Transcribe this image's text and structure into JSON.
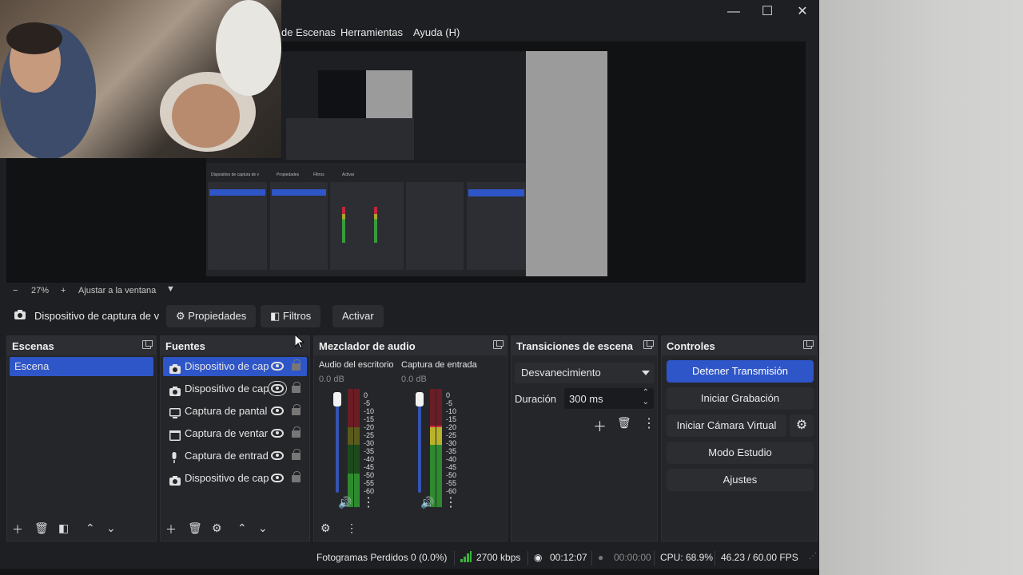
{
  "window": {
    "minimize": "—",
    "maximize": "☐",
    "close": "✕"
  },
  "menu": {
    "items": [
      "de Escenas",
      "Herramientas",
      "Ayuda (H)"
    ]
  },
  "zoom": {
    "minus": "−",
    "value": "27%",
    "plus": "+",
    "fit": "Ajustar a la ventana"
  },
  "context": {
    "source_name": "Dispositivo de captura de v",
    "properties": "Propiedades",
    "filters": "Filtros",
    "activate": "Activar"
  },
  "scenes": {
    "title": "Escenas",
    "items": [
      "Escena"
    ]
  },
  "sources": {
    "title": "Fuentes",
    "items": [
      {
        "label": "Dispositivo de cap",
        "icon": "camera-icon"
      },
      {
        "label": "Dispositivo de cap",
        "icon": "camera-icon"
      },
      {
        "label": "Captura de pantal",
        "icon": "monitor-icon"
      },
      {
        "label": "Captura de ventar",
        "icon": "window-icon"
      },
      {
        "label": "Captura de entrad",
        "icon": "microphone-icon"
      },
      {
        "label": "Dispositivo de cap",
        "icon": "camera-icon"
      }
    ]
  },
  "mixer": {
    "title": "Mezclador de audio",
    "channels": [
      {
        "name": "Audio del escritorio",
        "db": "0.0 dB",
        "level": 0.35
      },
      {
        "name": "Captura de entrada",
        "db": "0.0 dB",
        "level": 0.85
      }
    ],
    "scale": [
      "0",
      "-5",
      "-10",
      "-15",
      "-20",
      "-25",
      "-30",
      "-35",
      "-40",
      "-45",
      "-50",
      "-55",
      "-60"
    ]
  },
  "transitions": {
    "title": "Transiciones de escena",
    "selected": "Desvanecimiento",
    "duration_label": "Duración",
    "duration_value": "300 ms"
  },
  "controls": {
    "title": "Controles",
    "stop_stream": "Detener Transmisión",
    "start_recording": "Iniciar Grabación",
    "start_virtual_cam": "Iniciar Cámara Virtual",
    "studio_mode": "Modo Estudio",
    "settings": "Ajustes"
  },
  "status": {
    "dropped_frames": "Fotogramas Perdidos 0 (0.0%)",
    "bitrate": "2700 kbps",
    "stream_time": "00:12:07",
    "rec_time": "00:00:00",
    "cpu": "CPU: 68.9%",
    "fps": "46.23 / 60.00 FPS"
  },
  "colors": {
    "accent": "#2f56c8",
    "panel": "#25262a",
    "background": "#1e1f22"
  }
}
